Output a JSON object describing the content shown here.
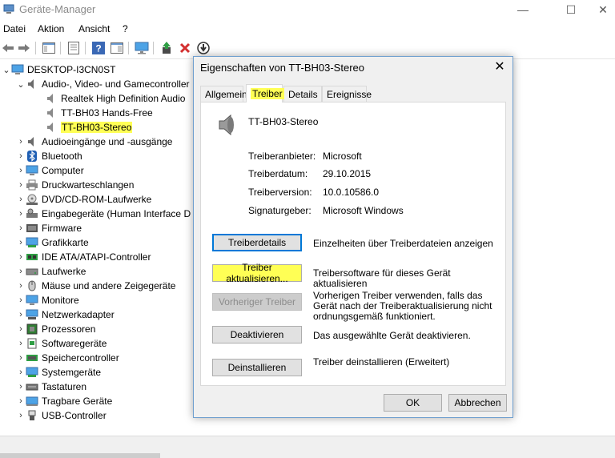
{
  "window": {
    "title": "Geräte-Manager",
    "controls": {
      "minimize": "—",
      "maximize": "☐",
      "close": "✕"
    }
  },
  "menu": [
    "Datei",
    "Aktion",
    "Ansicht",
    "?"
  ],
  "toolbar": {
    "icons": [
      "back-arrow-icon",
      "forward-arrow-icon",
      "console-tree-icon",
      "properties-icon",
      "help-icon",
      "view-icon",
      "monitor-icon",
      "update-driver-icon",
      "uninstall-icon",
      "download-icon"
    ]
  },
  "tree": {
    "root": "DESKTOP-I3CN0ST",
    "audio_category": "Audio-, Video- und Gamecontroller",
    "audio_children": [
      "Realtek High Definition Audio",
      "TT-BH03 Hands-Free",
      "TT-BH03-Stereo"
    ],
    "categories": [
      "Audioeingänge und -ausgänge",
      "Bluetooth",
      "Computer",
      "Druckwarteschlangen",
      "DVD/CD-ROM-Laufwerke",
      "Eingabegeräte (Human Interface D",
      "Firmware",
      "Grafikkarte",
      "IDE ATA/ATAPI-Controller",
      "Laufwerke",
      "Mäuse und andere Zeigegeräte",
      "Monitore",
      "Netzwerkadapter",
      "Prozessoren",
      "Softwaregeräte",
      "Speichercontroller",
      "Systemgeräte",
      "Tastaturen",
      "Tragbare Geräte",
      "USB-Controller"
    ]
  },
  "dialog": {
    "title": "Eigenschaften von TT-BH03-Stereo",
    "close": "✕",
    "tabs": [
      "Allgemein",
      "Treiber",
      "Details",
      "Ereignisse"
    ],
    "active_tab": "Treiber",
    "device_name": "TT-BH03-Stereo",
    "props": {
      "provider_label": "Treiberanbieter:",
      "provider_value": "Microsoft",
      "date_label": "Treiberdatum:",
      "date_value": "29.10.2015",
      "version_label": "Treiberversion:",
      "version_value": "10.0.10586.0",
      "signer_label": "Signaturgeber:",
      "signer_value": "Microsoft Windows"
    },
    "buttons": {
      "details": "Treiberdetails",
      "details_desc": "Einzelheiten über Treiberdateien anzeigen",
      "update": "Treiber aktualisieren...",
      "update_desc": "Treibersoftware für dieses Gerät aktualisieren",
      "rollback": "Vorheriger Treiber",
      "rollback_desc": "Vorherigen Treiber verwenden, falls das Gerät nach der Treiberaktualisierung nicht ordnungsgemäß funktioniert.",
      "disable": "Deaktivieren",
      "disable_desc": "Das ausgewählte Gerät deaktivieren.",
      "uninstall": "Deinstallieren",
      "uninstall_desc": "Treiber deinstallieren (Erweitert)"
    },
    "ok": "OK",
    "cancel": "Abbrechen"
  },
  "colors": {
    "highlight": "#ffff55",
    "dialog_border": "#6f9fcf",
    "focus": "#0078d7"
  }
}
